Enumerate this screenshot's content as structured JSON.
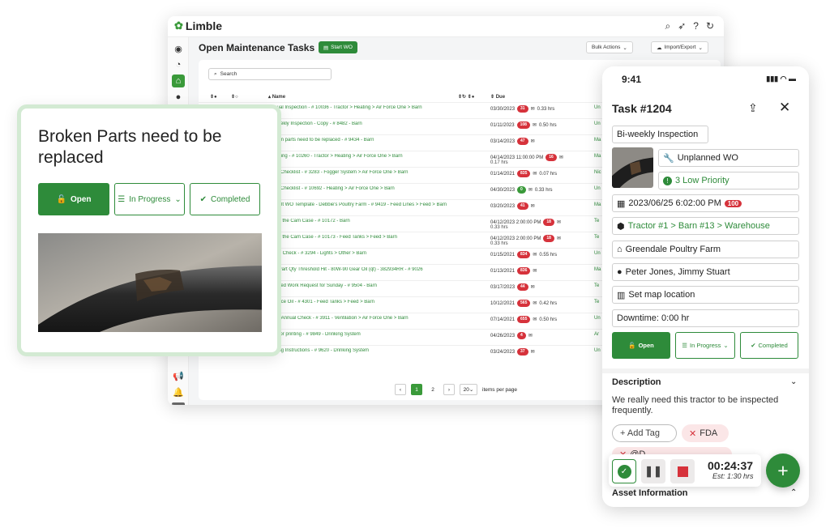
{
  "desktop": {
    "logo": "Limble",
    "page_title": "Open Maintenance Tasks",
    "start_wo": "Start WO",
    "bulk_actions": "Bulk Actions",
    "import_export": "Import/Export",
    "search_placeholder": "Search",
    "columns": {
      "name": "Name",
      "due": "Due"
    },
    "rows": [
      {
        "name": "Annual Inspection - # 10036 - Tractor > Heating > Air Force One > Barn",
        "due": "03/30/2023",
        "badge": "31",
        "hrs": "0.33 hrs",
        "loc": "Un"
      },
      {
        "name": "Bi-weekly Inspection - Copy - # 8482 - Barn",
        "due": "01/11/2023",
        "badge": "108",
        "hrs": "0.50 hrs",
        "loc": "Un"
      },
      {
        "name": "Broken parts need to be replaced - # 9434 - Barn",
        "due": "03/14/2023",
        "badge": "47",
        "hrs": "",
        "loc": "Ma"
      },
      {
        "name": "Cleaning - # 10260 - Tractor > Heating > Air Force One > Barn",
        "due": "04/14/2023 11:00:00 PM",
        "badge": "16",
        "hrs": "0.17 hrs",
        "loc": "Ma"
      },
      {
        "name": "Daily Checklist - # 3283 - Fogger System > Air Force One > Barn",
        "due": "01/14/2021",
        "badge": "835",
        "hrs": "0.07 hrs",
        "loc": "Nic"
      },
      {
        "name": "Daily Checklist - # 10692 - Heating > Air Force One > Barn",
        "due": "04/30/2023",
        "badge": "0",
        "hrs": "0.33 hrs",
        "loc": "Un"
      },
      {
        "name": "Default WO Template - Debbie's Poultry Farm - # 9419 - Feed Lines > Feed > Barn",
        "due": "03/20/2023",
        "badge": "41",
        "hrs": "",
        "loc": "Ma"
      },
      {
        "name": "Clean the Cam Case - # 10172 - Barn",
        "due": "04/12/2023 2:00:00 PM",
        "badge": "18",
        "hrs": "0.33 hrs",
        "loc": "Te"
      },
      {
        "name": "Clean the Cam Case - # 10173 - Feed Tanks > Feed > Barn",
        "due": "04/12/2023 2:00:00 PM",
        "badge": "18",
        "hrs": "0.33 hrs",
        "loc": "Te"
      },
      {
        "name": "Lights Check - # 3294 - Lights > Other > Barn",
        "due": "01/15/2021",
        "badge": "834",
        "hrs": "0.55 hrs",
        "loc": "Un"
      },
      {
        "name": "Low Part Qty Threshold Hit - 80W-90 Gear Oil (qt) - 382934RR - # 9026",
        "due": "01/13/2021",
        "badge": "836",
        "hrs": "",
        "loc": "Ma"
      },
      {
        "name": "Planned Work Request for Sunday - # 9504 - Barn",
        "due": "03/17/2023",
        "badge": "44",
        "hrs": "",
        "loc": "Te"
      },
      {
        "name": "Replace Oil - # 4301 - Feed Tanks > Feed > Barn",
        "due": "10/12/2021",
        "badge": "565",
        "hrs": "0.42 hrs",
        "loc": "Te"
      },
      {
        "name": "Semi-Annual Check - # 3911 - Ventilation > Air Force One > Barn",
        "due": "07/14/2021",
        "badge": "655",
        "hrs": "0.50 hrs",
        "loc": "Un"
      },
      {
        "name": "Test for printing - # 9849 - Drinking System",
        "due": "04/26/2023",
        "badge": "4",
        "hrs": "",
        "loc": "Ar"
      },
      {
        "name": "Testing Instructions - # 9620 - Drinking System",
        "due": "03/24/2023",
        "badge": "37",
        "hrs": "",
        "loc": "Un"
      }
    ],
    "pager": {
      "page1": "1",
      "page2": "2",
      "per_page": "20",
      "per_page_label": "items per page"
    }
  },
  "card": {
    "title": "Broken Parts need to be replaced",
    "open": "Open",
    "in_progress": "In Progress",
    "completed": "Completed"
  },
  "phone": {
    "time": "9:41",
    "title": "Task #1204",
    "name": "Bi-weekly Inspection",
    "type": "Unplanned WO",
    "priority": "3 Low Priority",
    "due": "2023/06/25  6:02:00 PM",
    "due_badge": "100",
    "asset_path": "Tractor #1 > Barn #13 > Warehouse",
    "location": "Greendale Poultry Farm",
    "assignees": "Peter Jones, Jimmy Stuart",
    "map": "Set map location",
    "downtime": "Downtime: 0:00 hr",
    "open": "Open",
    "in_progress": "In Progress",
    "completed": "Completed",
    "description_label": "Description",
    "description_text": "We really need this tractor to be inspected frequently.",
    "add_tag": "+ Add Tag",
    "tag_fda": "FDA",
    "tag_partial": "@D",
    "timer": "00:24:37",
    "estimate": "Est: 1:30 hrs",
    "asset_info": "Asset Information"
  },
  "colors": {
    "brand_green": "#2e8b3a",
    "badge_red": "#d6323b",
    "card_border": "#d3ead3"
  }
}
